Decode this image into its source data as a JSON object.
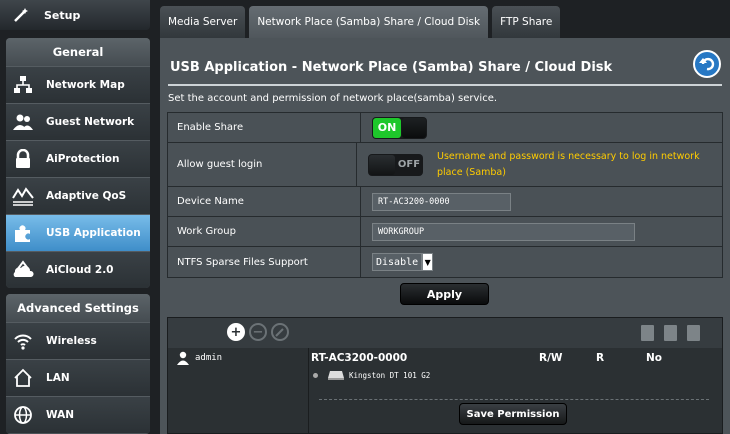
{
  "sidebar": {
    "setup_label": "Setup",
    "general": {
      "title": "General",
      "items": [
        {
          "label": "Network Map",
          "icon": "network-map-icon"
        },
        {
          "label": "Guest Network",
          "icon": "guest-network-icon"
        },
        {
          "label": "AiProtection",
          "icon": "lock-icon"
        },
        {
          "label": "Adaptive QoS",
          "icon": "qos-icon"
        },
        {
          "label": "USB Application",
          "icon": "puzzle-icon",
          "active": true
        },
        {
          "label": "AiCloud 2.0",
          "icon": "cloud-icon"
        }
      ]
    },
    "advanced": {
      "title": "Advanced Settings",
      "items": [
        {
          "label": "Wireless",
          "icon": "wifi-icon"
        },
        {
          "label": "LAN",
          "icon": "home-icon"
        },
        {
          "label": "WAN",
          "icon": "globe-icon"
        }
      ]
    }
  },
  "tabs": [
    {
      "label": "Media Server"
    },
    {
      "label": "Network Place (Samba) Share / Cloud Disk",
      "active": true
    },
    {
      "label": "FTP Share"
    }
  ],
  "main": {
    "title": "USB Application - Network Place (Samba) Share / Cloud Disk",
    "description": "Set the account and permission of network place(samba) service.",
    "fields": {
      "enable_share": {
        "label": "Enable Share",
        "state": "ON"
      },
      "guest_login": {
        "label": "Allow guest login",
        "state": "OFF",
        "warning": "Username and password is necessary to log in network place (Samba)"
      },
      "device_name": {
        "label": "Device Name",
        "value": "RT-AC3200-0000"
      },
      "work_group": {
        "label": "Work Group",
        "value": "WORKGROUP"
      },
      "ntfs": {
        "label": "NTFS Sparse Files Support",
        "value": "Disable"
      }
    },
    "apply_label": "Apply"
  },
  "permissions": {
    "user": "admin",
    "device": "RT-AC3200-0000",
    "col_rw": "R/W",
    "col_r": "R",
    "col_no": "No",
    "disk": "Kingston DT 101 G2",
    "save_label": "Save Permission"
  },
  "colors": {
    "accent": "#3f8ec9",
    "on": "#1ec72b",
    "warning": "#ffcc00"
  }
}
